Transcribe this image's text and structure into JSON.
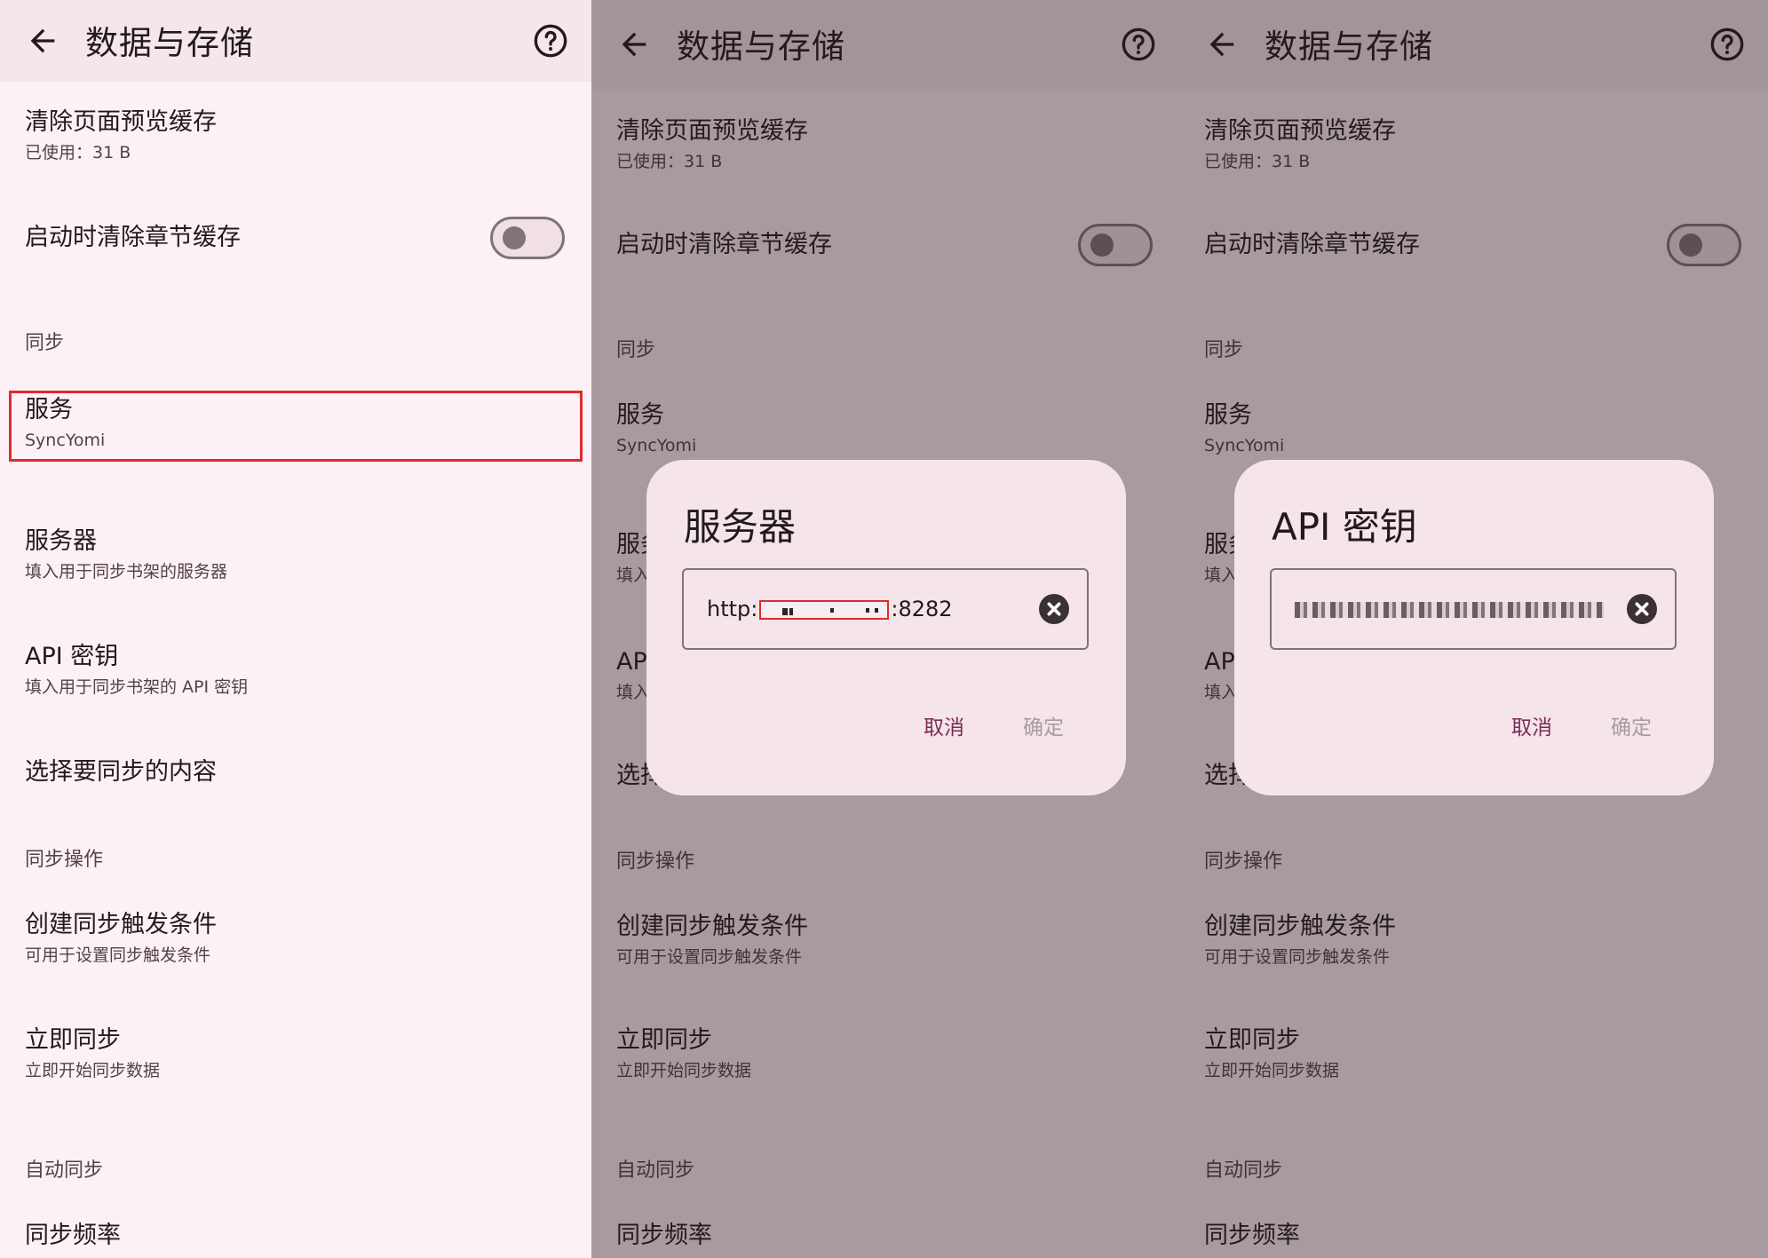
{
  "appbar": {
    "title": "数据与存储"
  },
  "items": {
    "clear_cache": {
      "title": "清除页面预览缓存",
      "sub": "已使用：31 B"
    },
    "startup_clear": {
      "title": "启动时清除章节缓存"
    },
    "cat_sync": "同步",
    "service": {
      "title": "服务",
      "sub": "SyncYomi"
    },
    "server": {
      "title": "服务器",
      "sub": "填入用于同步书架的服务器"
    },
    "api_key": {
      "title": "API 密钥",
      "sub": "填入用于同步书架的 API 密钥"
    },
    "select_content": {
      "title": "选择要同步的内容"
    },
    "cat_sync_ops": "同步操作",
    "create_trigger": {
      "title": "创建同步触发条件",
      "sub": "可用于设置同步触发条件"
    },
    "sync_now": {
      "title": "立即同步",
      "sub": "立即开始同步数据"
    },
    "cat_auto_sync": "自动同步",
    "sync_freq": {
      "title": "同步频率"
    }
  },
  "server_dialog": {
    "title": "服务器",
    "value_prefix": "http:",
    "value_suffix": ":8282",
    "cancel": "取消",
    "confirm": "确定"
  },
  "api_dialog": {
    "title": "API 密钥",
    "cancel": "取消",
    "confirm": "确定"
  },
  "colors": {
    "highlight": "#e02a2a",
    "accent_text": "#7a2d52",
    "disabled_text": "#a89ba1"
  }
}
